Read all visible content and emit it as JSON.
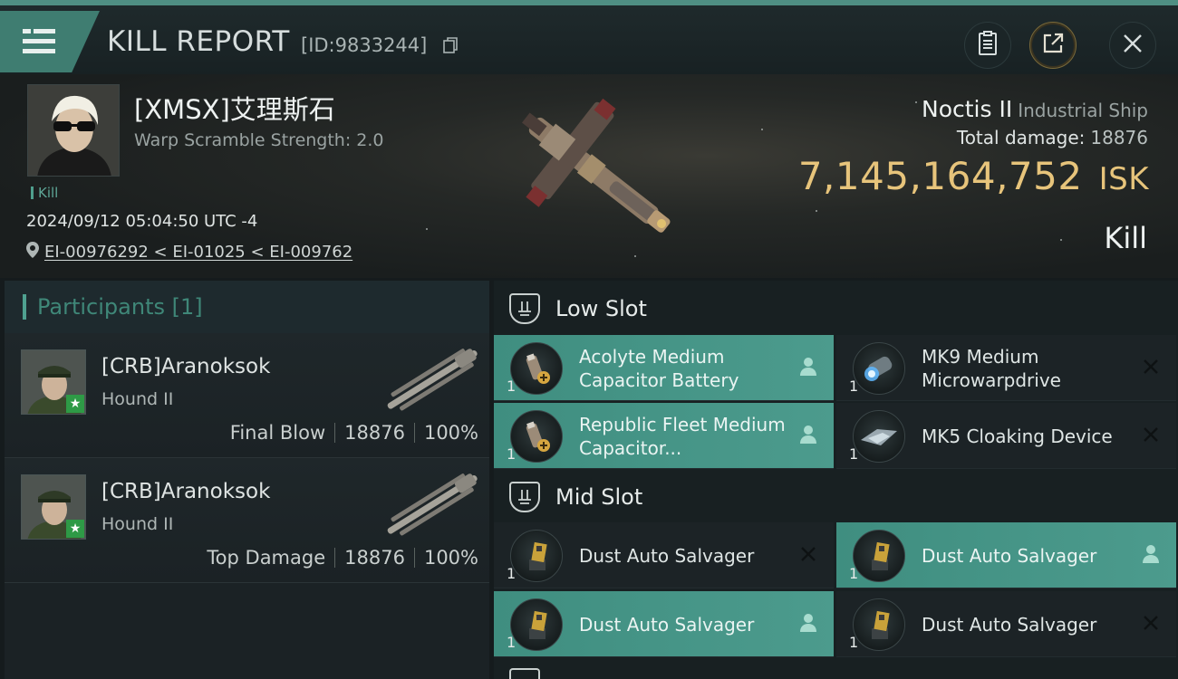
{
  "header": {
    "title": "KILL REPORT",
    "report_id": "[ID:9833244]",
    "icons": [
      "menu-icon",
      "copy-icon",
      "clipboard-icon",
      "share-icon",
      "close-icon"
    ]
  },
  "victim": {
    "name": "[XMSX]艾理斯石",
    "warp_scramble": "Warp Scramble Strength: 2.0",
    "tag": "Kill",
    "datetime": "2024/09/12 05:04:50 UTC -4",
    "location": "EI-00976292 < EI-01025 < EI-009762",
    "ship_name": "Noctis II",
    "ship_class": "Industrial Ship",
    "total_damage_label": "Total damage:",
    "total_damage": "18876",
    "isk_value": "7,145,164,752",
    "isk_unit": "ISK",
    "result": "Kill"
  },
  "participants": {
    "header": "Participants [1]",
    "rows": [
      {
        "name": "[CRB]Aranoksok",
        "ship": "Hound II",
        "role": "Final Blow",
        "damage": "18876",
        "percent": "100%"
      },
      {
        "name": "[CRB]Aranoksok",
        "ship": "Hound II",
        "role": "Top Damage",
        "damage": "18876",
        "percent": "100%"
      }
    ]
  },
  "slots": {
    "low_slot": {
      "label": "Low Slot",
      "modules": [
        {
          "name": "Acolyte Medium Capacitor Battery",
          "qty": "1",
          "status": "dropped",
          "icon": "capacitor-battery-icon"
        },
        {
          "name": "MK9 Medium Microwarpdrive",
          "qty": "1",
          "status": "destroyed",
          "icon": "microwarpdrive-icon"
        },
        {
          "name": "Republic Fleet Medium Capacitor...",
          "qty": "1",
          "status": "dropped",
          "icon": "capacitor-battery-icon"
        },
        {
          "name": "MK5 Cloaking Device",
          "qty": "1",
          "status": "destroyed",
          "icon": "cloaking-device-icon"
        }
      ]
    },
    "mid_slot": {
      "label": "Mid Slot",
      "modules": [
        {
          "name": "Dust Auto Salvager",
          "qty": "1",
          "status": "destroyed",
          "icon": "salvager-icon"
        },
        {
          "name": "Dust Auto Salvager",
          "qty": "1",
          "status": "dropped",
          "icon": "salvager-icon"
        },
        {
          "name": "Dust Auto Salvager",
          "qty": "1",
          "status": "dropped",
          "icon": "salvager-icon"
        },
        {
          "name": "Dust Auto Salvager",
          "qty": "1",
          "status": "destroyed",
          "icon": "salvager-icon"
        }
      ]
    }
  },
  "colors": {
    "accent": "#4c9b8d",
    "isk": "#e7c47b",
    "participants_header": "#3f8778"
  }
}
